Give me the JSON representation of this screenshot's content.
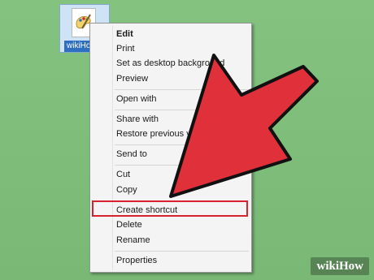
{
  "desktop": {
    "file_label": "wikiHo"
  },
  "context_menu": {
    "items": [
      {
        "label": "Edit"
      },
      {
        "label": "Print"
      },
      {
        "label": "Set as desktop background"
      },
      {
        "label": "Preview"
      },
      {
        "label": "Open with"
      },
      {
        "label": "Share with"
      },
      {
        "label": "Restore previous versions"
      },
      {
        "label": "Send to"
      },
      {
        "label": "Cut"
      },
      {
        "label": "Copy"
      },
      {
        "label": "Create shortcut"
      },
      {
        "label": "Delete"
      },
      {
        "label": "Rename"
      },
      {
        "label": "Properties"
      }
    ],
    "highlighted_item": "Create shortcut",
    "highlight_color": "#d6232f"
  },
  "overlay": {
    "arrow_color": "#e0303a",
    "arrow_outline": "#111111"
  },
  "watermark": {
    "text_a": "wiki",
    "text_b": "How"
  }
}
